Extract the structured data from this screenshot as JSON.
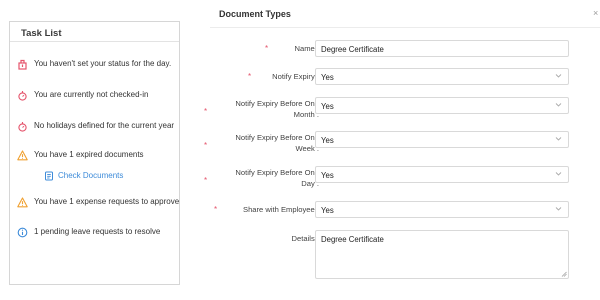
{
  "task_list": {
    "title": "Task List",
    "items": [
      {
        "icon": "warning-flag-icon",
        "color": "#e5546c",
        "text": "You haven't set your status for the day."
      },
      {
        "icon": "stopwatch-icon",
        "color": "#e5546c",
        "text": "You are currently not checked-in"
      },
      {
        "icon": "stopwatch-icon",
        "color": "#e5546c",
        "text": "No holidays defined for the current year"
      },
      {
        "icon": "warning-triangle-icon",
        "color": "#f0a030",
        "text": "You have 1 expired documents"
      },
      {
        "icon": "warning-triangle-icon",
        "color": "#f0a030",
        "text": "You have 1 expense requests to approve"
      },
      {
        "icon": "info-circle-icon",
        "color": "#3d8bd9",
        "text": "1 pending leave requests to resolve"
      }
    ],
    "check_documents_link": {
      "icon": "document-icon",
      "label": "Check Documents"
    }
  },
  "document_types": {
    "title": "Document Types",
    "close_icon": "close-icon",
    "fields": {
      "name": {
        "label": "Name",
        "value": "Degree Certificate"
      },
      "notify_expiry": {
        "label": "Notify Expiry",
        "value": "Yes"
      },
      "notify_month": {
        "label_line1": "Notify Expiry Before One",
        "label_line2": "Month",
        "value": "Yes"
      },
      "notify_week": {
        "label_line1": "Notify Expiry Before One",
        "label_line2": "Week",
        "value": "Yes"
      },
      "notify_day": {
        "label_line1": "Notify Expiry Before One",
        "label_line2": "Day",
        "value": "Yes"
      },
      "share_with_employee": {
        "label": "Share with Employee",
        "value": "Yes"
      },
      "details": {
        "label": "Details",
        "value": "Degree Certificate"
      }
    }
  },
  "colors": {
    "required": "#e5546c",
    "warning": "#f0a030",
    "info": "#3d8bd9",
    "link": "#3d8bd9"
  }
}
